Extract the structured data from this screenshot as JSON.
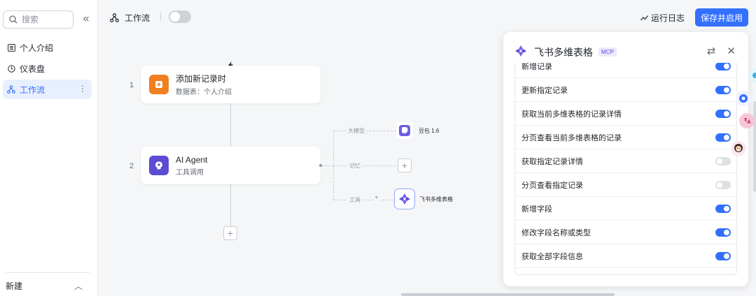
{
  "sidebar": {
    "search_placeholder": "搜索",
    "items": [
      {
        "label": "个人介绍"
      },
      {
        "label": "仪表盘"
      },
      {
        "label": "工作流"
      }
    ],
    "footer_label": "新建"
  },
  "topbar": {
    "title": "工作流",
    "log_label": "运行日志",
    "save_label": "保存并启用"
  },
  "canvas": {
    "steps": [
      {
        "num": "1",
        "title": "添加新记录时",
        "subtitle": "数据表：个人介绍"
      },
      {
        "num": "2",
        "title": "AI Agent",
        "subtitle": "工具调用"
      }
    ],
    "branches": {
      "model_label": "大模型",
      "model_name": "豆包 1.6",
      "memory_label": "记忆",
      "tool_label": "工具",
      "tool_name": "飞书多维表格"
    }
  },
  "panel": {
    "title": "飞书多维表格",
    "badge": "MCP",
    "tools": [
      {
        "label": "新增记录",
        "enabled": true
      },
      {
        "label": "更新指定记录",
        "enabled": true
      },
      {
        "label": "获取当前多维表格的记录详情",
        "enabled": true
      },
      {
        "label": "分页查看当前多维表格的记录",
        "enabled": true
      },
      {
        "label": "获取指定记录详情",
        "enabled": false
      },
      {
        "label": "分页查看指定记录",
        "enabled": false
      },
      {
        "label": "新增字段",
        "enabled": true
      },
      {
        "label": "修改字段名称或类型",
        "enabled": true
      },
      {
        "label": "获取全部字段信息",
        "enabled": true
      }
    ]
  },
  "colors": {
    "accent": "#3370ff",
    "trigger_orange": "#f07f1f",
    "agent_purple": "#5b4cd3"
  }
}
